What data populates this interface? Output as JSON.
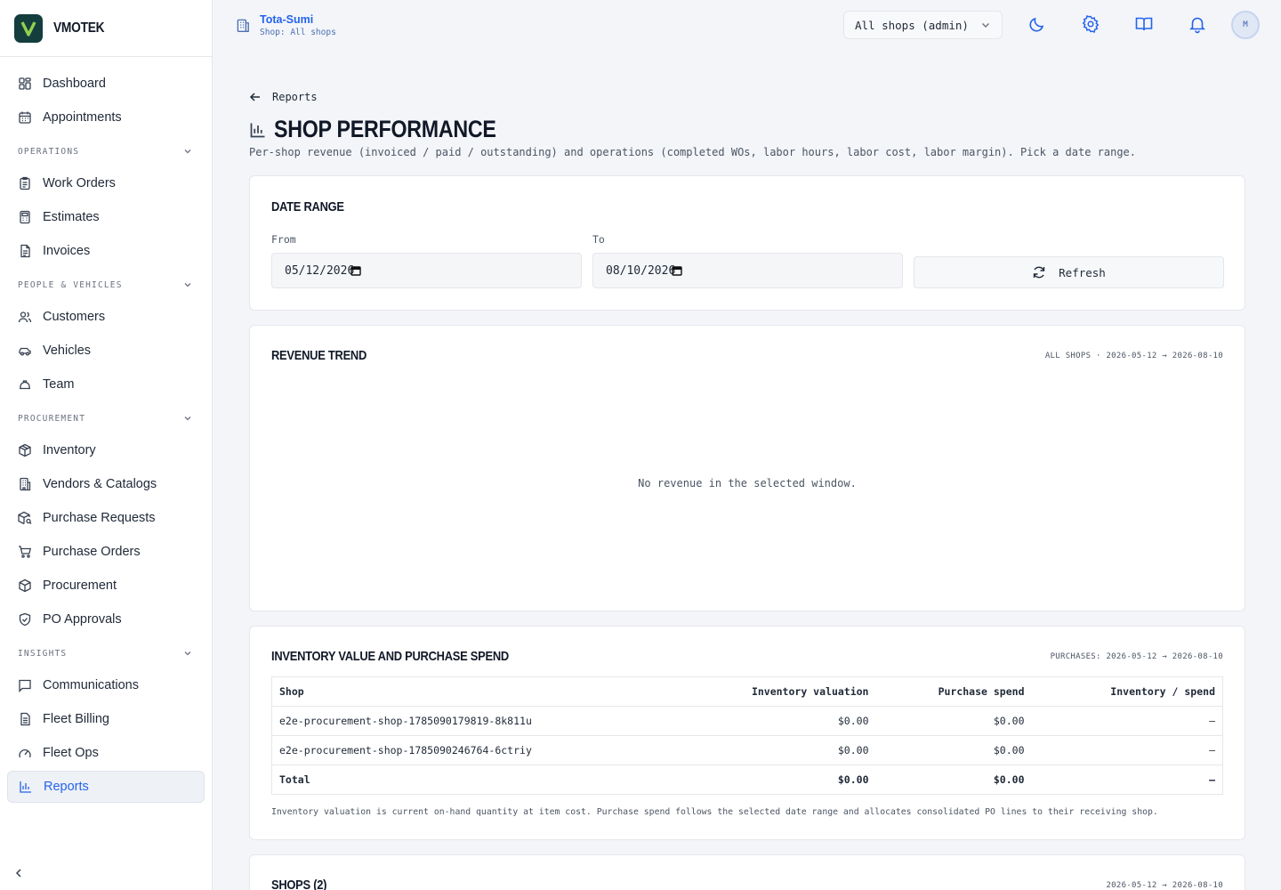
{
  "brand": {
    "name": "VMOTEK",
    "logo_letter": "V"
  },
  "sidebar": {
    "top_items": [
      {
        "label": "Dashboard",
        "icon": "dashboard-icon"
      },
      {
        "label": "Appointments",
        "icon": "calendar-icon"
      }
    ],
    "sections": [
      {
        "title": "OPERATIONS",
        "items": [
          {
            "label": "Work Orders",
            "icon": "clipboard-icon"
          },
          {
            "label": "Estimates",
            "icon": "calculator-icon"
          },
          {
            "label": "Invoices",
            "icon": "invoice-icon"
          }
        ]
      },
      {
        "title": "PEOPLE & VEHICLES",
        "items": [
          {
            "label": "Customers",
            "icon": "users-icon"
          },
          {
            "label": "Vehicles",
            "icon": "car-icon"
          },
          {
            "label": "Team",
            "icon": "hard-hat-icon"
          }
        ]
      },
      {
        "title": "PROCUREMENT",
        "items": [
          {
            "label": "Inventory",
            "icon": "package-icon"
          },
          {
            "label": "Vendors & Catalogs",
            "icon": "building-icon"
          },
          {
            "label": "Purchase Requests",
            "icon": "package-search-icon"
          },
          {
            "label": "Purchase Orders",
            "icon": "cart-icon"
          },
          {
            "label": "Procurement",
            "icon": "box-icon"
          },
          {
            "label": "PO Approvals",
            "icon": "shield-check-icon"
          }
        ]
      },
      {
        "title": "INSIGHTS",
        "items": [
          {
            "label": "Communications",
            "icon": "message-icon"
          },
          {
            "label": "Fleet Billing",
            "icon": "receipt-icon"
          },
          {
            "label": "Fleet Ops",
            "icon": "gauge-icon"
          },
          {
            "label": "Reports",
            "icon": "bar-chart-icon",
            "active": true
          }
        ]
      }
    ]
  },
  "topbar": {
    "tenant_name": "Tota-Sumi",
    "tenant_sub": "Shop: All shops",
    "shop_select": "All shops (admin)",
    "avatar": "M"
  },
  "page": {
    "back_label": "Reports",
    "title": "SHOP PERFORMANCE",
    "subtitle": "Per-shop revenue (invoiced / paid / outstanding) and operations (completed WOs, labor hours, labor cost, labor margin). Pick a date range."
  },
  "date_range": {
    "title": "DATE RANGE",
    "from_label": "From",
    "from_value": "05/12/2026",
    "to_label": "To",
    "to_value": "08/10/2026",
    "refresh_label": "Refresh"
  },
  "revenue": {
    "title": "REVENUE TREND",
    "meta": "ALL SHOPS · 2026-05-12 → 2026-08-10",
    "empty": "No revenue in the selected window."
  },
  "inventory": {
    "title": "INVENTORY VALUE AND PURCHASE SPEND",
    "meta": "PURCHASES: 2026-05-12 → 2026-08-10",
    "columns": [
      "Shop",
      "Inventory valuation",
      "Purchase spend",
      "Inventory / spend"
    ],
    "rows": [
      [
        "e2e-procurement-shop-1785090179819-8k811u",
        "$0.00",
        "$0.00",
        "—"
      ],
      [
        "e2e-procurement-shop-1785090246764-6ctriy",
        "$0.00",
        "$0.00",
        "—"
      ]
    ],
    "total": [
      "Total",
      "$0.00",
      "$0.00",
      "—"
    ],
    "note": "Inventory valuation is current on-hand quantity at item cost. Purchase spend follows the selected date range and allocates consolidated PO lines to their receiving shop."
  },
  "shops": {
    "title": "SHOPS (2)",
    "meta": "2026-05-12 → 2026-08-10"
  }
}
